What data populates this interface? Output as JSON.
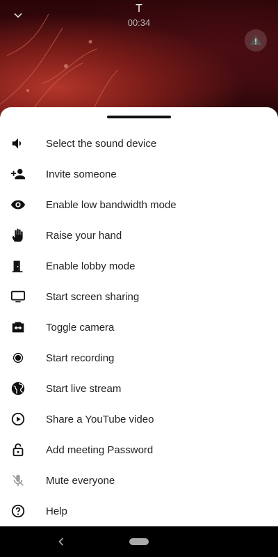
{
  "call": {
    "participant_initial": "T",
    "timer": "00:34"
  },
  "menu": [
    {
      "label": "Select the sound device",
      "icon": "volume-icon"
    },
    {
      "label": "Invite someone",
      "icon": "person-add-icon"
    },
    {
      "label": "Enable low bandwidth mode",
      "icon": "eye-icon"
    },
    {
      "label": "Raise your hand",
      "icon": "hand-icon"
    },
    {
      "label": "Enable lobby mode",
      "icon": "door-icon"
    },
    {
      "label": "Start screen sharing",
      "icon": "monitor-icon"
    },
    {
      "label": "Toggle camera",
      "icon": "camera-switch-icon"
    },
    {
      "label": "Start recording",
      "icon": "record-icon"
    },
    {
      "label": "Start live stream",
      "icon": "globe-icon"
    },
    {
      "label": "Share a YouTube video",
      "icon": "play-circle-icon"
    },
    {
      "label": "Add meeting Password",
      "icon": "lock-icon"
    },
    {
      "label": "Mute everyone",
      "icon": "mic-off-icon"
    },
    {
      "label": "Help",
      "icon": "help-icon"
    }
  ],
  "colors": {
    "sheet_bg": "#ffffff",
    "text": "#222222",
    "icon": "#111111",
    "mute_icon": "#9e9e9e"
  }
}
